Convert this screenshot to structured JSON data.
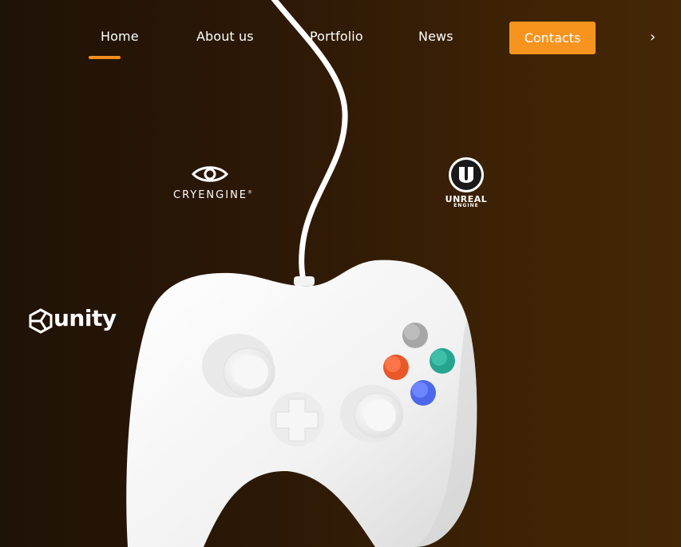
{
  "nav": {
    "items": [
      {
        "label": "Home",
        "active": true
      },
      {
        "label": "About us"
      },
      {
        "label": "Portfolio"
      },
      {
        "label": "News"
      }
    ],
    "contacts_label": "Contacts",
    "next_glyph": "›"
  },
  "logos": {
    "cryengine": "CRYENGINE",
    "cryengine_mark": "®",
    "unreal_line1": "UNREAL",
    "unreal_line2": "ENGINE",
    "unity": "unity"
  },
  "colors": {
    "accent": "#f7941f",
    "background_dark": "#1f1207",
    "background_warm": "#452706",
    "button_gray": "#9a9a9a",
    "button_teal": "#2bae98",
    "button_orange": "#f2612f",
    "button_blue": "#5a74f2"
  },
  "icons": [
    "chevron-right-icon",
    "cryengine-eye-icon",
    "unreal-u-icon",
    "unity-cube-icon"
  ]
}
